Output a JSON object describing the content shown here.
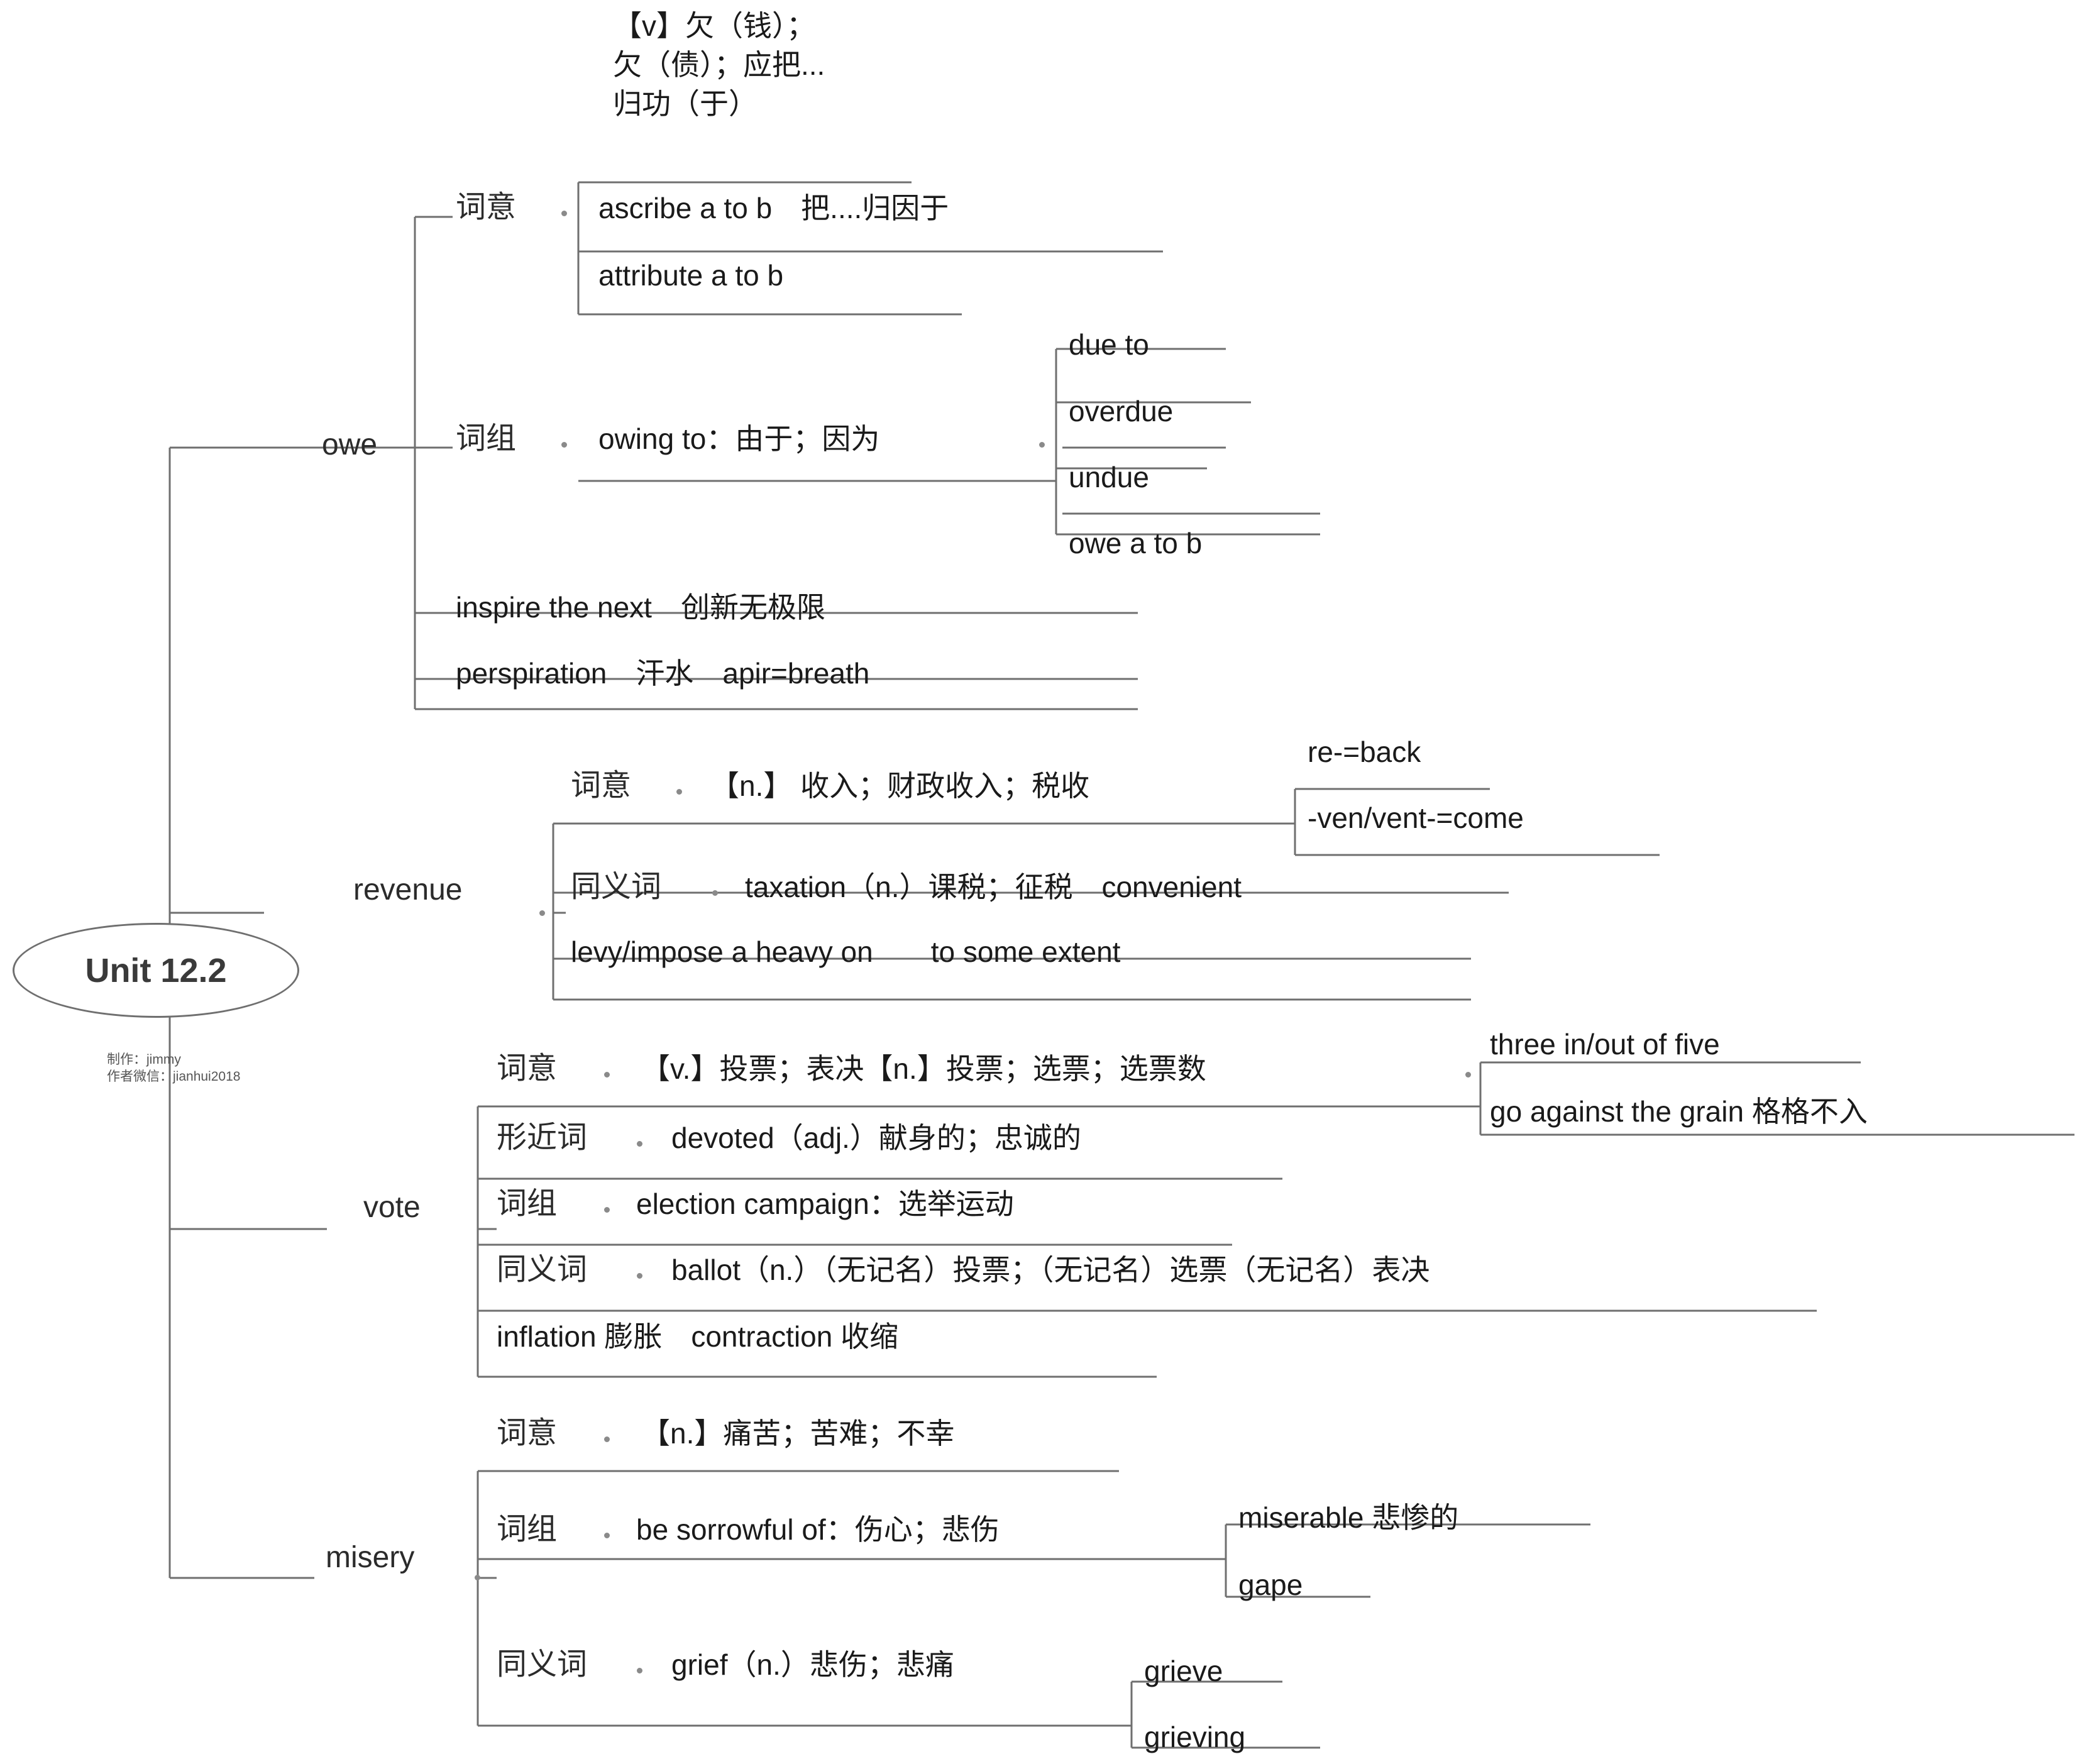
{
  "root": {
    "label": "Unit 12.2",
    "credit_line1": "制作：jimmy",
    "credit_line2": "作者微信：jianhui2018"
  },
  "branches": [
    {
      "name": "owe",
      "label": "owe",
      "children": [
        {
          "name": "owe-ciyi",
          "label": "词意",
          "meaning_lines": [
            "【v】欠（钱）；",
            "欠（债）；应把...",
            "归功（于）"
          ],
          "items": [
            "ascribe a  to  b　把....归因于",
            "attribute  a  to  b"
          ]
        },
        {
          "name": "owe-cizu",
          "label": "词组",
          "items": [
            "owing to：由于；因为"
          ],
          "sub": [
            "due to",
            "overdue",
            "undue",
            "owe a  to  b"
          ]
        },
        {
          "name": "owe-extra",
          "items": [
            "inspire  the  next　创新无极限",
            "perspiration　汗水　apir=breath"
          ]
        }
      ]
    },
    {
      "name": "revenue",
      "label": "revenue",
      "children": [
        {
          "name": "revenue-ciyi",
          "label": "词意",
          "items": [
            "【n.】 收入；财政收入；税收"
          ],
          "sub": [
            "re-=back",
            "-ven/vent-=come"
          ]
        },
        {
          "name": "revenue-tongyici",
          "label": "同义词",
          "items": [
            "taxation（n.）课税；征税　convenient"
          ]
        },
        {
          "name": "revenue-extra",
          "items": [
            "levy/impose  a  heavy on　　to  some  extent"
          ]
        }
      ]
    },
    {
      "name": "vote",
      "label": "vote",
      "children": [
        {
          "name": "vote-ciyi",
          "label": "词意",
          "items": [
            "【v.】投票；表决【n.】投票；选票；选票数"
          ],
          "sub": [
            "three in/out of five",
            "go against the grain 格格不入"
          ]
        },
        {
          "name": "vote-xingjinci",
          "label": "形近词",
          "items": [
            "devoted（adj.）献身的；忠诚的"
          ]
        },
        {
          "name": "vote-cizu",
          "label": "词组",
          "items": [
            "election campaign：选举运动"
          ]
        },
        {
          "name": "vote-tongyici",
          "label": "同义词",
          "items": [
            "ballot（n.）（无记名）投票；（无记名）选票（无记名）表决"
          ]
        },
        {
          "name": "vote-extra",
          "items": [
            "inflation  膨胀　contraction 收缩"
          ]
        }
      ]
    },
    {
      "name": "misery",
      "label": "misery",
      "children": [
        {
          "name": "misery-ciyi",
          "label": "词意",
          "items": [
            "【n.】痛苦；苦难；不幸"
          ]
        },
        {
          "name": "misery-cizu",
          "label": "词组",
          "items": [
            "be sorrowful of：伤心；悲伤"
          ],
          "sub": [
            "miserable 悲惨的",
            "gape"
          ]
        },
        {
          "name": "misery-tongyici",
          "label": "同义词",
          "items": [
            "grief（n.）悲伤；悲痛"
          ],
          "sub": [
            "grieve",
            "grieving"
          ]
        }
      ]
    }
  ],
  "colors": {
    "line": "#6f6f6f",
    "text": "#1a1a1a",
    "root_border": "#6f6f6f"
  }
}
